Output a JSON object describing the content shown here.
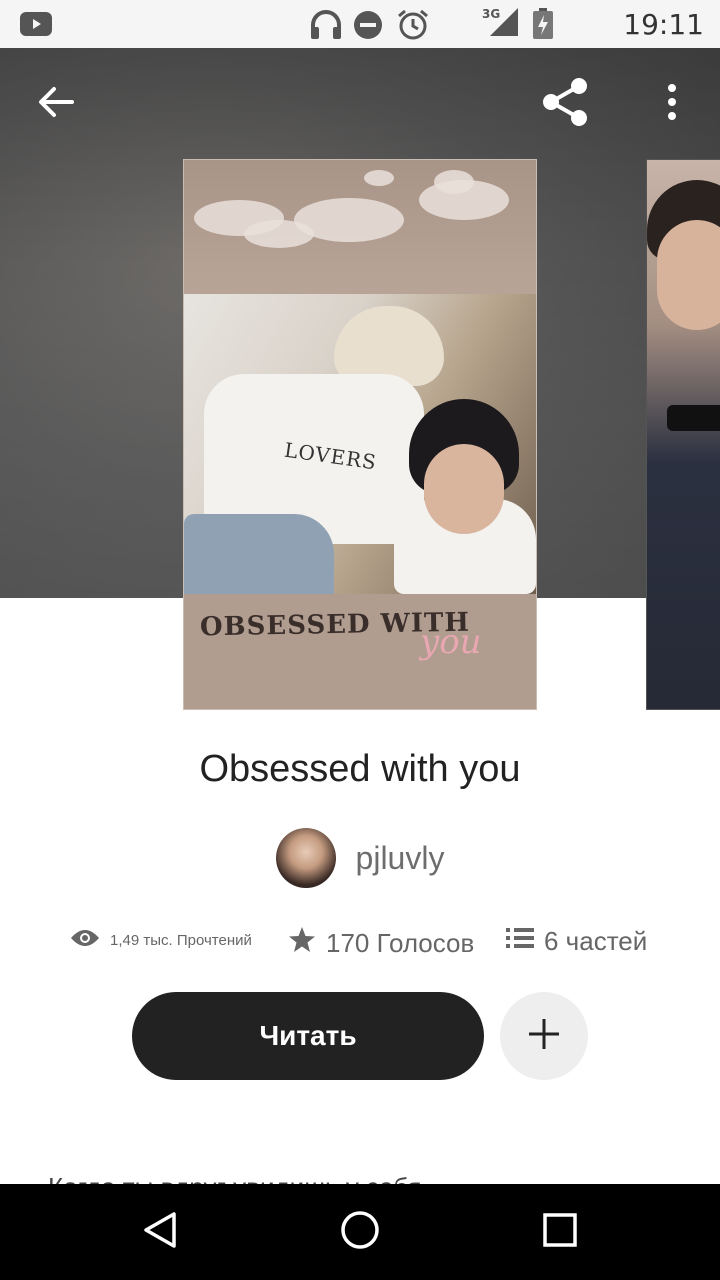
{
  "status_bar": {
    "time": "19:11",
    "network": "3G",
    "icons": [
      "youtube-icon",
      "headphones-icon",
      "do-not-disturb-icon",
      "alarm-icon",
      "signal-icon",
      "battery-icon"
    ]
  },
  "header": {
    "back_icon": "arrow-left-icon",
    "share_icon": "share-icon",
    "menu_icon": "more-vertical-icon"
  },
  "cover": {
    "shirt_text": "LOVERS",
    "title_text": "OBSESSED WITH",
    "title_script": "you"
  },
  "story": {
    "title": "Obsessed with you",
    "author": "pjluvly",
    "stats": {
      "reads": "1,49 тыс. Прочтений",
      "votes": "170 Голосов",
      "parts": "6 частей"
    },
    "read_label": "Читать",
    "description_peek": "Когда ты вдруг увидишь у себя..."
  },
  "nav": {
    "back_icon": "nav-back-icon",
    "home_icon": "nav-home-icon",
    "recents_icon": "nav-recents-icon"
  },
  "colors": {
    "read_button": "#222222",
    "add_button": "#eeeeee",
    "nav_bar": "#000000"
  }
}
